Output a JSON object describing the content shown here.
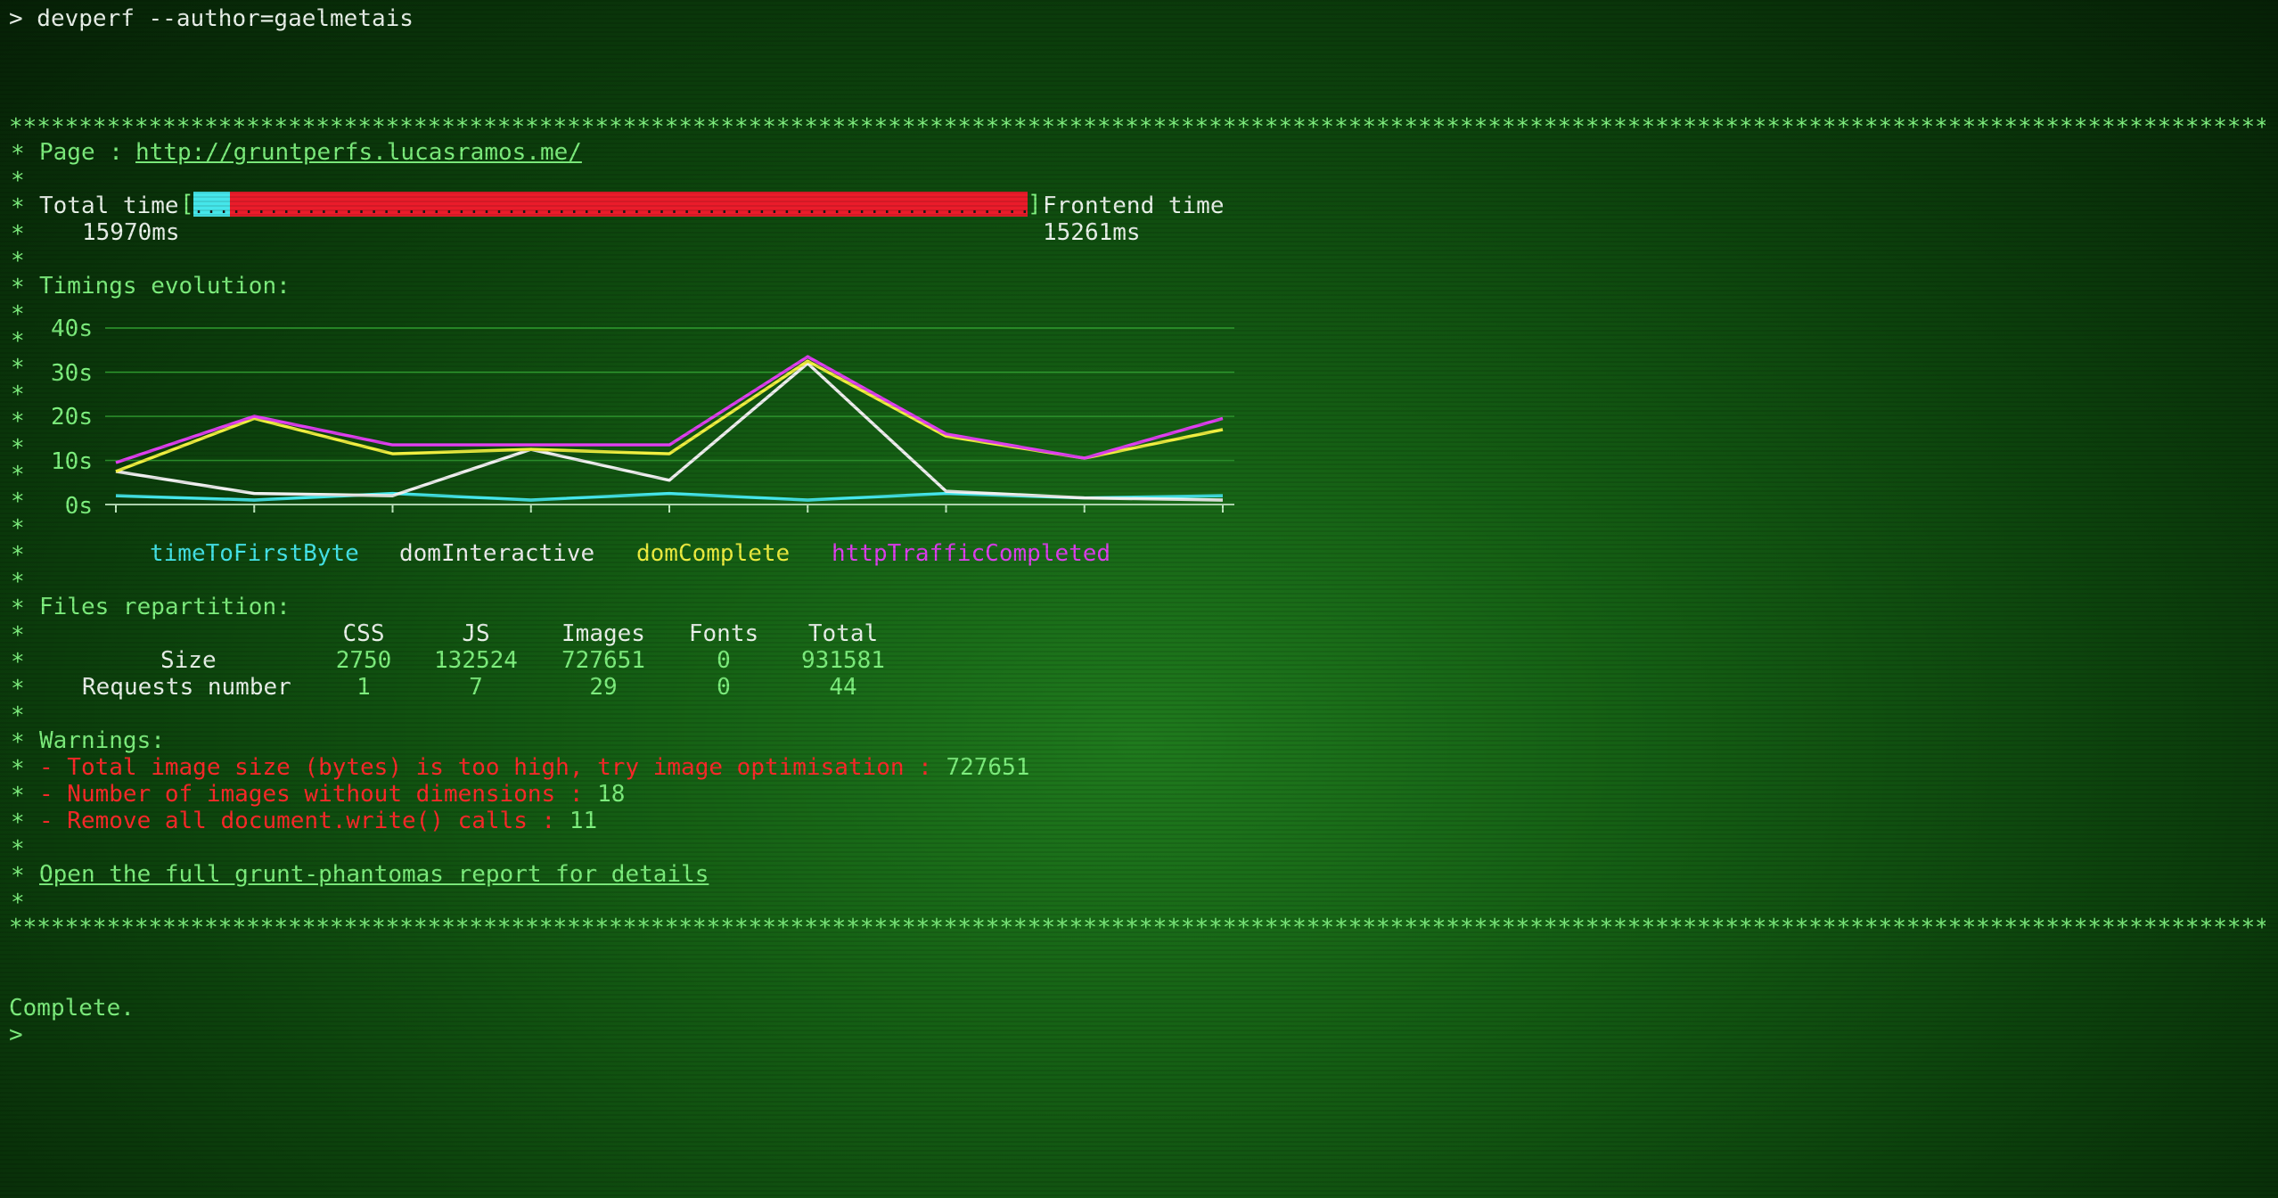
{
  "prompt_line": "> devperf --author=gaelmetais",
  "border_stars": "****************************************************************************************************************************************************************************************************",
  "gutter_star": "*",
  "page_label": "Page : ",
  "page_url": "http://gruntperfs.lucasramos.me/",
  "total_time": {
    "label": "Total time",
    "value": "15970ms"
  },
  "frontend_time": {
    "label": "Frontend time",
    "value": "15261ms"
  },
  "timing_bar": {
    "open_bracket": "[",
    "close_bracket": "]",
    "frontend_fraction": 0.956,
    "dots": "...................................................................................................................",
    "colors": {
      "backend": "#45e6ea",
      "frontend": "#ea1c2a"
    }
  },
  "timings_heading": "Timings evolution:",
  "chart_data": {
    "type": "line",
    "x": [
      1,
      2,
      3,
      4,
      5,
      6,
      7,
      8,
      9
    ],
    "ylim": [
      0,
      40
    ],
    "yticks": [
      "0s",
      "10s",
      "20s",
      "30s",
      "40s"
    ],
    "grid": true,
    "legend": "bottom",
    "series": [
      {
        "name": "timeToFirstByte",
        "color": "#45e6ea",
        "values": [
          2,
          1,
          2.5,
          1,
          2.5,
          1,
          2.5,
          1.5,
          2
        ]
      },
      {
        "name": "domInteractive",
        "color": "#f0f0f0",
        "values": [
          7.5,
          2.5,
          2,
          12.5,
          5.5,
          32,
          3,
          1.5,
          1
        ]
      },
      {
        "name": "domComplete",
        "color": "#f0f040",
        "values": [
          7.5,
          19.5,
          11.5,
          12.5,
          11.5,
          32.5,
          15.5,
          10.5,
          17
        ]
      },
      {
        "name": "httpTrafficCompleted",
        "color": "#e040f0",
        "values": [
          9.5,
          20,
          13.5,
          13.5,
          13.5,
          33.5,
          16,
          10.5,
          19.5
        ]
      }
    ]
  },
  "files_heading": "Files repartition:",
  "files_table": {
    "headers": [
      "CSS",
      "JS",
      "Images",
      "Fonts",
      "Total"
    ],
    "rows": [
      {
        "label": "Size",
        "values": [
          "2750",
          "132524",
          "727651",
          "0",
          "931581"
        ]
      },
      {
        "label": "Requests number",
        "values": [
          "1",
          "7",
          "29",
          "0",
          "44"
        ]
      }
    ]
  },
  "warnings_heading": "Warnings:",
  "warnings": [
    {
      "text": "- Total image size (bytes) is too high, try image optimisation : ",
      "value": "727651"
    },
    {
      "text": "- Number of images without dimensions : ",
      "value": "18"
    },
    {
      "text": "- Remove all document.write() calls : ",
      "value": "11"
    }
  ],
  "report_link": "Open the full grunt-phantomas report for details",
  "complete_text": "Complete.",
  "final_prompt": ">"
}
